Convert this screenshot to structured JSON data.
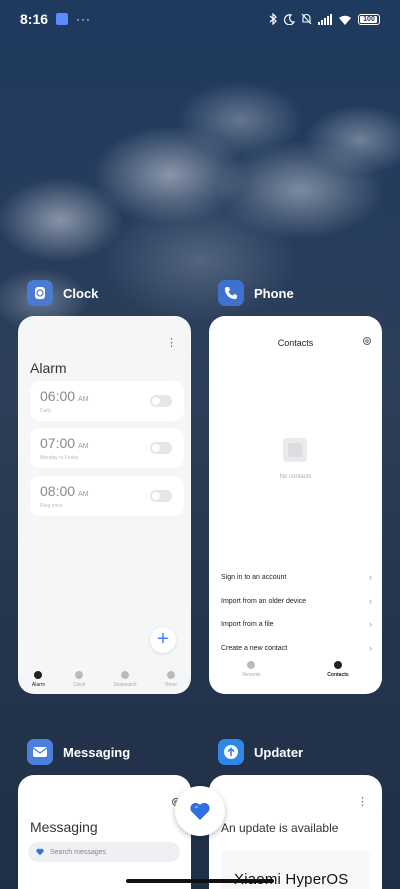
{
  "status_bar": {
    "time": "8:16",
    "dots": "···",
    "battery": "100"
  },
  "apps": {
    "clock": {
      "name": "Clock",
      "icon": "clock-app-icon",
      "screen_title": "Alarm",
      "alarms": [
        {
          "time": "06:00",
          "ampm": "AM",
          "subtitle": "Daily",
          "enabled": false
        },
        {
          "time": "07:00",
          "ampm": "AM",
          "subtitle": "Monday to Friday",
          "enabled": false
        },
        {
          "time": "08:00",
          "ampm": "AM",
          "subtitle": "Ring once",
          "enabled": false
        }
      ],
      "add_label": "+",
      "nav": [
        "Alarm",
        "Clock",
        "Stopwatch",
        "Timer"
      ]
    },
    "phone": {
      "name": "Phone",
      "icon": "phone-app-icon",
      "screen_title": "Contacts",
      "empty_text": "No contacts",
      "actions": [
        "Sign in to an account",
        "Import from an older device",
        "Import from a file",
        "Create a new contact"
      ],
      "nav": [
        "Recents",
        "Contacts"
      ]
    },
    "messaging": {
      "name": "Messaging",
      "icon": "messaging-app-icon",
      "screen_title": "Messaging",
      "search_placeholder": "Search messages"
    },
    "updater": {
      "name": "Updater",
      "icon": "updater-app-icon",
      "screen_title": "An update is available",
      "logo_text": "Xiaomi HyperOS"
    }
  },
  "colors": {
    "accent": "#3d7dff",
    "clock_icon_bg": "#4a7bd1",
    "phone_icon_bg": "#3f72cf",
    "messaging_icon_bg": "#4b7fdc",
    "updater_icon_bg": "#2f87e8"
  }
}
